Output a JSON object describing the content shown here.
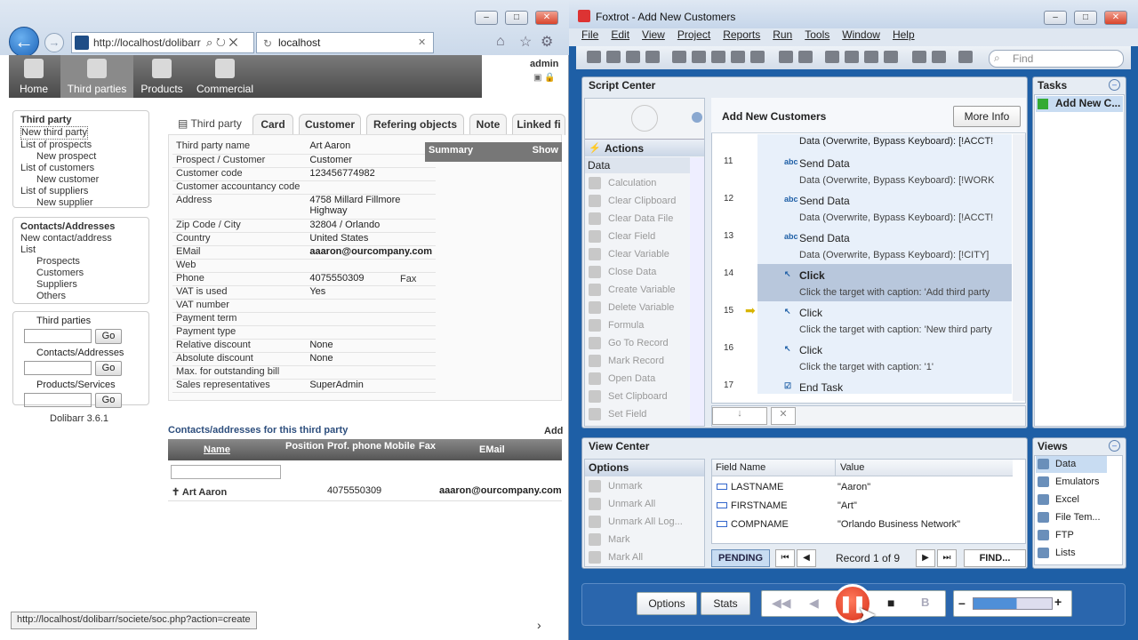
{
  "browser": {
    "address": "http://localhost/dolibarr",
    "tab_title": "localhost",
    "status_url": "http://localhost/dolibarr/societe/soc.php?action=create",
    "user": "admin",
    "nav": [
      "Home",
      "Third parties",
      "Products",
      "Commercial"
    ]
  },
  "left_menu": {
    "third_party": {
      "title": "Third party",
      "items": [
        "New third party",
        "List of prospects",
        "New prospect",
        "List of customers",
        "New customer",
        "List of suppliers",
        "New supplier"
      ]
    },
    "contacts": {
      "title": "Contacts/Addresses",
      "items": [
        "New contact/address",
        "List",
        "Prospects",
        "Customers",
        "Suppliers",
        "Others"
      ]
    },
    "search": {
      "third_parties": "Third parties",
      "contacts": "Contacts/Addresses",
      "products": "Products/Services",
      "go": "Go"
    },
    "version": "Dolibarr 3.6.1"
  },
  "tabs": [
    "Third party",
    "Card",
    "Customer",
    "Refering objects",
    "Note",
    "Linked fi"
  ],
  "card": [
    [
      "Third party name",
      "Art Aaron"
    ],
    [
      "Prospect / Customer",
      "Customer"
    ],
    [
      "Customer code",
      "123456774982"
    ],
    [
      "Customer accountancy code",
      ""
    ],
    [
      "Address",
      "4758 Millard Fillmore Highway"
    ],
    [
      "Zip Code / City",
      "32804 / Orlando"
    ],
    [
      "Country",
      "United States"
    ],
    [
      "EMail",
      "aaaron@ourcompany.com"
    ],
    [
      "Web",
      ""
    ],
    [
      "Phone",
      "4075550309"
    ],
    [
      "VAT is used",
      "Yes"
    ],
    [
      "VAT number",
      ""
    ],
    [
      "Payment term",
      ""
    ],
    [
      "Payment type",
      ""
    ],
    [
      "Relative discount",
      "None"
    ],
    [
      "Absolute discount",
      "None"
    ],
    [
      "Max. for outstanding bill",
      ""
    ],
    [
      "Sales representatives",
      "SuperAdmin"
    ]
  ],
  "fax_label": "Fax",
  "summary": {
    "title": "Summary",
    "show": "Show"
  },
  "contacts_section": {
    "title": "Contacts/addresses for this third party",
    "add": "Add",
    "columns": [
      "Name",
      "Position",
      "Prof. phone",
      "Mobile",
      "Fax",
      "EMail"
    ],
    "row": {
      "name": "Art Aaron",
      "phone": "4075550309",
      "email": "aaaron@ourcompany.com"
    }
  },
  "foxtrot": {
    "title": "Foxtrot - Add New Customers",
    "menu": [
      "File",
      "Edit",
      "View",
      "Project",
      "Reports",
      "Run",
      "Tools",
      "Window",
      "Help"
    ],
    "find_placeholder": "Find",
    "script_center": "Script Center",
    "actions_label": "Actions",
    "data_label": "Data",
    "actions": [
      "Calculation",
      "Clear Clipboard",
      "Clear Data File",
      "Clear Field",
      "Clear Variable",
      "Close Data",
      "Create Variable",
      "Delete Variable",
      "Formula",
      "Go To Record",
      "Mark Record",
      "Open Data",
      "Set Clipboard",
      "Set Field"
    ],
    "script_title": "Add New Customers",
    "more_info": "More Info",
    "top_partial": "Data (Overwrite, Bypass Keyboard): [!ACCT!",
    "steps": [
      {
        "n": "11",
        "a": "Send Data",
        "b": "Data (Overwrite, Bypass Keyboard): [!WORK"
      },
      {
        "n": "12",
        "a": "Send Data",
        "b": "Data (Overwrite, Bypass Keyboard): [!ACCT!"
      },
      {
        "n": "13",
        "a": "Send Data",
        "b": "Data (Overwrite, Bypass Keyboard): [!CITY]"
      },
      {
        "n": "14",
        "a": "Click",
        "b": "Click the target with caption: 'Add third party"
      },
      {
        "n": "15",
        "a": "Click",
        "b": "Click the target with caption: 'New third party"
      },
      {
        "n": "16",
        "a": "Click",
        "b": "Click the target with caption: '1'"
      },
      {
        "n": "17",
        "a": "End Task",
        "b": ""
      }
    ],
    "tasks_label": "Tasks",
    "task_item": "Add New C...",
    "view_center": "View Center",
    "options_label": "Options",
    "options": [
      "Unmark",
      "Unmark All",
      "Unmark All Log...",
      "Mark",
      "Mark All"
    ],
    "field_col": "Field Name",
    "value_col": "Value",
    "fields": [
      [
        "LASTNAME",
        "\"Aaron\""
      ],
      [
        "FIRSTNAME",
        "\"Art\""
      ],
      [
        "COMPNAME",
        "\"Orlando Business Network\""
      ]
    ],
    "pending": "PENDING",
    "record": "Record 1 of 9",
    "find_btn": "FIND...",
    "views_label": "Views",
    "views": [
      "Data",
      "Emulators",
      "Excel",
      "File Tem...",
      "FTP",
      "Lists"
    ],
    "bottom": {
      "options": "Options",
      "stats": "Stats"
    }
  }
}
